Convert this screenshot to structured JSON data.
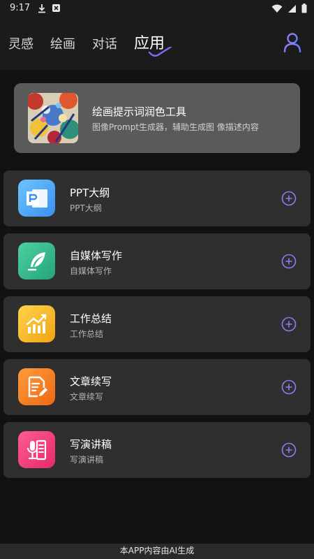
{
  "status_bar": {
    "time": "9:17",
    "icons": [
      "download-icon",
      "notification-icon",
      "wifi-icon",
      "signal-icon",
      "battery-icon"
    ]
  },
  "header": {
    "tabs": [
      {
        "label": "灵感"
      },
      {
        "label": "绘画"
      },
      {
        "label": "对话"
      },
      {
        "label": "应用"
      }
    ],
    "active_tab": "应用",
    "user_icon": "user-icon",
    "accent_color": "#7b6cf6"
  },
  "featured": {
    "title": "绘画提示词润色工具",
    "description": "图像Prompt生成器，辅助生成图 像描述内容"
  },
  "apps": [
    {
      "title": "PPT大纲",
      "subtitle": "PPT大纲",
      "icon": "ppt-icon",
      "color": "#4aa8f5"
    },
    {
      "title": "自媒体写作",
      "subtitle": "自媒体写作",
      "icon": "feather-icon",
      "color": "#2fb98a"
    },
    {
      "title": "工作总结",
      "subtitle": "工作总结",
      "icon": "chart-icon",
      "color": "#f0b11c"
    },
    {
      "title": "文章续写",
      "subtitle": "文章续写",
      "icon": "document-edit-icon",
      "color": "#f07a22"
    },
    {
      "title": "写演讲稿",
      "subtitle": "写演讲稿",
      "icon": "microphone-doc-icon",
      "color": "#ef3b7f"
    }
  ],
  "footer": {
    "text": "本APP内容由AI生成"
  }
}
